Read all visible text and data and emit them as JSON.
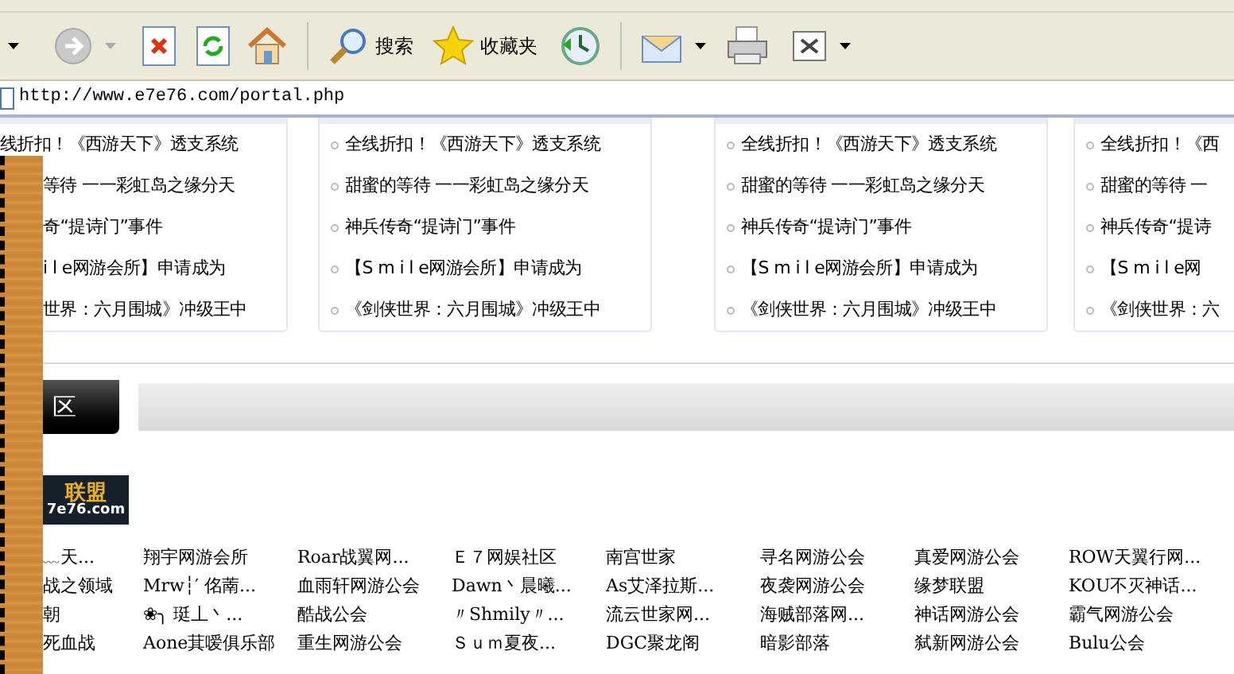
{
  "toolbar": {
    "search_label": "搜索",
    "favorites_label": "收藏夹"
  },
  "address": {
    "url": "http://www.e7e76.com/portal.php"
  },
  "news_cards": [
    {
      "items": [
        "线折扣！《西游天下》透支系统",
        "等待 一一彩虹岛之缘分天",
        "奇“提诗门”事件",
        "i l e网游会所】申请成为",
        "世界：六月围城》冲级王中"
      ]
    },
    {
      "items": [
        "全线折扣！《西游天下》透支系统",
        "甜蜜的等待 一一彩虹岛之缘分天",
        "神兵传奇“提诗门”事件",
        "【S m i l e网游会所】申请成为",
        "《剑侠世界：六月围城》冲级王中"
      ]
    },
    {
      "items": [
        "全线折扣！《西游天下》透支系统",
        "甜蜜的等待 一一彩虹岛之缘分天",
        "神兵传奇“提诗门”事件",
        "【S m i l e网游会所】申请成为",
        "《剑侠世界：六月围城》冲级王中"
      ]
    },
    {
      "items": [
        "全线折扣！《西",
        "甜蜜的等待 一",
        "神兵传奇“提诗",
        "【S m i l e网",
        "《剑侠世界：六"
      ]
    }
  ],
  "tab": {
    "label": "区"
  },
  "logo": {
    "title": "联盟",
    "domain": "7e76.com"
  },
  "guild_rows": [
    [
      "﹏天...",
      "翔宇网游会所",
      "Roar战翼网...",
      "Ｅ７网娱社区",
      "南宫世家",
      "寻名网游公会",
      "真爱网游公会",
      "ROW天翼行网..."
    ],
    [
      "战之领域",
      "Mrw┆′ 佲萳...",
      "血雨轩网游公会",
      "Dawn丶晨曦...",
      "As艾泽拉斯...",
      "夜袭网游公会",
      "缘梦联盟",
      "KOU不灭神话..."
    ],
    [
      "朝",
      "❀╮ 珽丄丶...",
      "酷战公会",
      "〃Shmily〃...",
      "流云世家网...",
      "海贼部落网...",
      "神话网游公会",
      "霸气网游公会"
    ],
    [
      "死血战",
      "Aone萁嗳俱乐部",
      "重生网游公会",
      "Ｓｕｍ夏夜...",
      "DGC聚龙阁",
      "暗影部落",
      "弑新网游公会",
      "Bulu公会"
    ]
  ]
}
